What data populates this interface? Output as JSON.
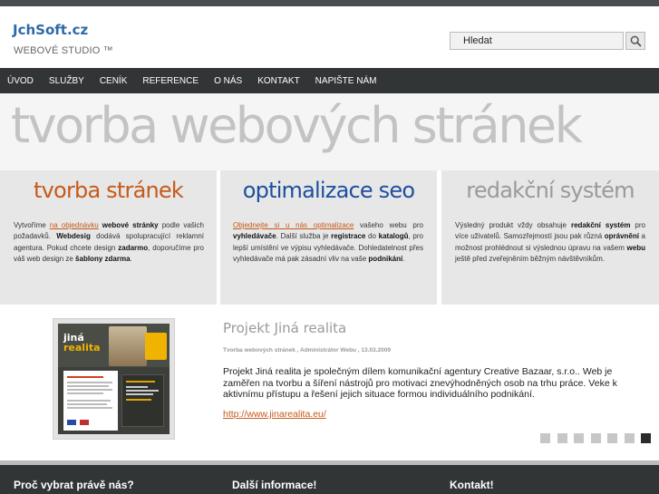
{
  "header": {
    "logo": "JchSoft.cz",
    "tagline": "WEBOVÉ STUDIO ™",
    "search_placeholder": "Hledat",
    "search_icon": "magnifier-icon"
  },
  "nav": {
    "items": [
      "ÚVOD",
      "SLUŽBY",
      "CENÍK",
      "REFERENCE",
      "O NÁS",
      "KONTAKT",
      "NAPIŠTE NÁM"
    ]
  },
  "hero": {
    "title": "tvorba webových stránek"
  },
  "columns": [
    {
      "title": "tvorba stránek",
      "color": "#c55a1a",
      "text": [
        "Vytvoříme ",
        "na objednávku",
        " ",
        "webové stránky",
        " podle vašich požadavků. ",
        "Webdesig",
        " dodává spolupracující reklamní agentura. Pokud chcete design ",
        "zadarmo",
        ", doporučíme pro váš web design ze ",
        "šablony zdarma",
        "."
      ]
    },
    {
      "title": "optimalizace seo",
      "color": "#1d4f9f",
      "text": [
        "Objednejte si u nás optimalizace",
        " vašeho webu pro ",
        "vyhledávače",
        ". Další služba je ",
        "registrace",
        " do ",
        "katalogů",
        ", pro lepší umístění ve výpisu vyhledávače. Dohledatelnost přes vyhledávače má pak zásadní vliv na vaše ",
        "podnikání",
        "."
      ]
    },
    {
      "title": "redakční systém",
      "color": "#9a9a9a",
      "text": [
        "Výsledný produkt vždy obsahuje ",
        "redakční systém",
        " pro více uživatelů. Samozřejmostí jsou pak různá ",
        "oprávnění",
        " a možnost prohlédnout si výslednou úpravu na vašem ",
        "webu",
        " ještě před zveřejněním běžným návštěvníkům."
      ]
    }
  ],
  "project": {
    "title": "Projekt Jiná realita",
    "meta": "Tvorba webových stránek , Administrátor Webu , 13.03.2009",
    "description": "Projekt Jiná realita je společným dílem komunikační agentury Creative Bazaar, s.r.o.. Web je zaměřen na tvorbu a šíření nástrojů pro motivaci znevýhodněných osob na trhu práce. Veke k aktivnímu přístupu a řešení jejich situace formou individuálního podnikání.",
    "link": "http://www.jinarealita.eu/",
    "thumb_logo_line1": "jiná",
    "thumb_logo_line2": "realita",
    "pager_count": 7,
    "pager_active": 6
  },
  "footer": {
    "headings": [
      "Proč vybrat právě nás?",
      "Další informace!",
      "Kontakt!"
    ]
  }
}
